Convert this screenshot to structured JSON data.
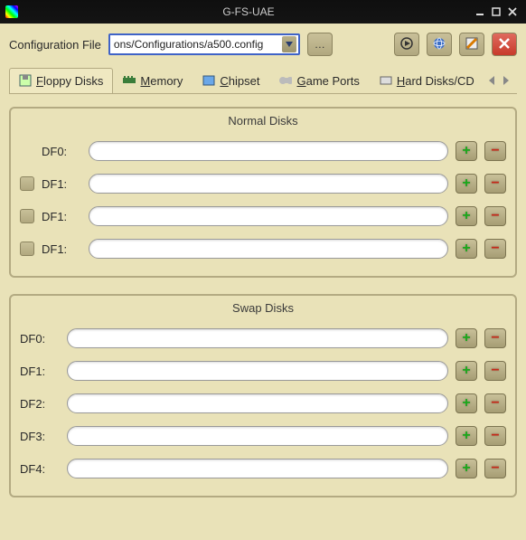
{
  "window": {
    "title": "G-FS-UAE"
  },
  "toolbar": {
    "config_label": "Configuration File",
    "config_value": "ons/Configurations/a500.config"
  },
  "tabs": {
    "items": [
      {
        "label": "Floppy Disks",
        "ul": "F",
        "active": true
      },
      {
        "label": "Memory",
        "ul": "M",
        "active": false
      },
      {
        "label": "Chipset",
        "ul": "C",
        "active": false
      },
      {
        "label": "Game Ports",
        "ul": "G",
        "active": false
      },
      {
        "label": "Hard Disks/CD",
        "ul": "H",
        "active": false
      }
    ]
  },
  "normal": {
    "title": "Normal Disks",
    "rows": [
      {
        "label": "DF0:",
        "checkbox": false,
        "value": ""
      },
      {
        "label": "DF1:",
        "checkbox": true,
        "value": ""
      },
      {
        "label": "DF1:",
        "checkbox": true,
        "value": ""
      },
      {
        "label": "DF1:",
        "checkbox": true,
        "value": ""
      }
    ]
  },
  "swap": {
    "title": "Swap Disks",
    "rows": [
      {
        "label": "DF0:",
        "value": ""
      },
      {
        "label": "DF1:",
        "value": ""
      },
      {
        "label": "DF2:",
        "value": ""
      },
      {
        "label": "DF3:",
        "value": ""
      },
      {
        "label": "DF4:",
        "value": ""
      }
    ]
  }
}
